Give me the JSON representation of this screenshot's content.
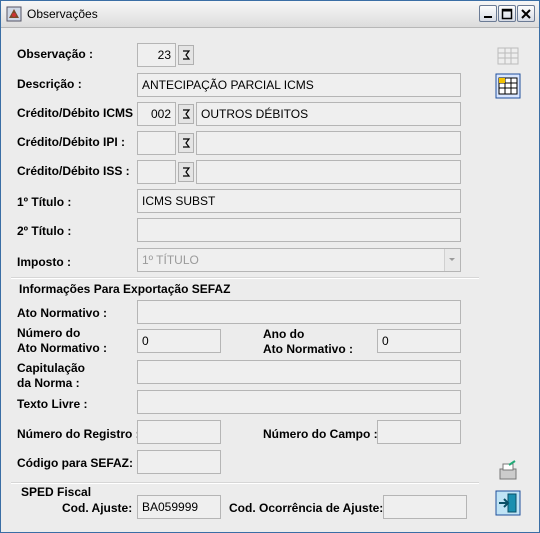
{
  "window": {
    "title": "Observações"
  },
  "fields": {
    "observacao": {
      "label": "Observação :",
      "value": "23"
    },
    "descricao": {
      "label": "Descrição :",
      "value": "ANTECIPAÇÃO PARCIAL ICMS"
    },
    "credito_debito_icms": {
      "label": "Crédito/Débito ICMS :",
      "code": "002",
      "desc": "OUTROS DÉBITOS"
    },
    "credito_debito_ipi": {
      "label": "Crédito/Débito IPI :",
      "code": "",
      "desc": ""
    },
    "credito_debito_iss": {
      "label": "Crédito/Débito ISS :",
      "code": "",
      "desc": ""
    },
    "titulo1": {
      "label": "1º Título :",
      "value": "ICMS SUBST"
    },
    "titulo2": {
      "label": "2º Título :",
      "value": ""
    },
    "imposto": {
      "label": "Imposto :",
      "value": "1º TÍTULO"
    }
  },
  "sefaz": {
    "section_title": "Informações Para Exportação SEFAZ",
    "ato_normativo": {
      "label": "Ato Normativo :",
      "value": ""
    },
    "numero_ato": {
      "label_line1": "Número do",
      "label_line2": "Ato Normativo :",
      "value": "0"
    },
    "ano_ato": {
      "label_line1": "Ano do",
      "label_line2": "Ato Normativo :",
      "value": "0"
    },
    "capitulacao": {
      "label_line1": "Capitulação",
      "label_line2": "da Norma :",
      "value": ""
    },
    "texto_livre": {
      "label": "Texto Livre :",
      "value": ""
    },
    "numero_registro": {
      "label": "Número do Registro :",
      "value": ""
    },
    "numero_campo": {
      "label": "Número do Campo :",
      "value": ""
    },
    "codigo_sefaz": {
      "label": "Código para SEFAZ:",
      "value": ""
    }
  },
  "sped": {
    "section_title": "SPED Fiscal",
    "cod_ajuste": {
      "label": "Cod. Ajuste:",
      "value": "BA059999"
    },
    "cod_ocorrencia": {
      "label": "Cod. Ocorrência de Ajuste:",
      "value": ""
    }
  },
  "colors": {
    "accent": "#3a6ea5",
    "field_bg": "#efefef",
    "window_bg": "#ececec"
  }
}
